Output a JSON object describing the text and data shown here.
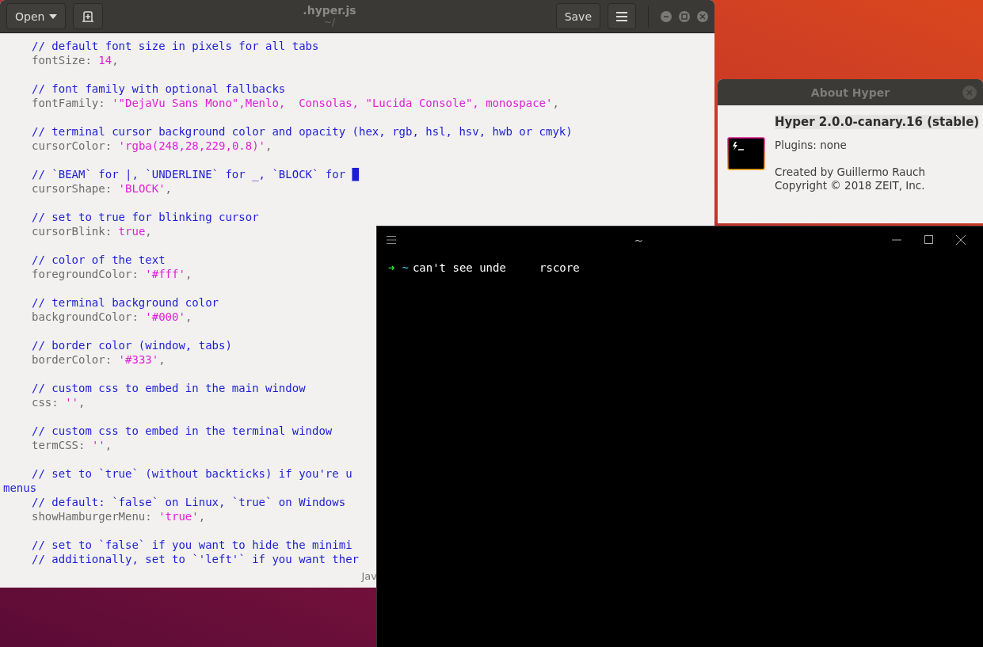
{
  "editor": {
    "title": ".hyper.js",
    "subtitle": "~/",
    "open_button": "Open",
    "save_button": "Save",
    "blocks": [
      {
        "comments": [
          {
            "text": "// default font size in pixels for all tabs",
            "wrapped": false
          }
        ],
        "key": "fontSize:",
        "value": "14",
        "end": ","
      },
      {
        "comments": [
          {
            "text": "// font family with optional fallbacks",
            "wrapped": false
          }
        ],
        "key": "fontFamily:",
        "value": "'\"DejaVu Sans Mono\",Menlo,  Consolas, \"Lucida Console\", monospace'",
        "end": ","
      },
      {
        "comments": [
          {
            "text": "// terminal cursor background color and opacity (hex, rgb, hsl, hsv, hwb or cmyk)",
            "wrapped": false
          }
        ],
        "key": "cursorColor:",
        "value": "'rgba(248,28,229,0.8)'",
        "end": ","
      },
      {
        "comments": [
          {
            "text": "// `BEAM` for |, `UNDERLINE` for _, `BLOCK` for █",
            "wrapped": false
          }
        ],
        "key": "cursorShape:",
        "value": "'BLOCK'",
        "end": ","
      },
      {
        "comments": [
          {
            "text": "// set to true for blinking cursor",
            "wrapped": false
          }
        ],
        "key": "cursorBlink:",
        "value": "true",
        "end": ","
      },
      {
        "comments": [
          {
            "text": "// color of the text",
            "wrapped": false
          }
        ],
        "key": "foregroundColor:",
        "value": "'#fff'",
        "end": ","
      },
      {
        "comments": [
          {
            "text": "// terminal background color",
            "wrapped": false
          }
        ],
        "key": "backgroundColor:",
        "value": "'#000'",
        "end": ","
      },
      {
        "comments": [
          {
            "text": "// border color (window, tabs)",
            "wrapped": false
          }
        ],
        "key": "borderColor:",
        "value": "'#333'",
        "end": ","
      },
      {
        "comments": [
          {
            "text": "// custom css to embed in the main window",
            "wrapped": false
          }
        ],
        "key": "css:",
        "value": "''",
        "end": ","
      },
      {
        "comments": [
          {
            "text": "// custom css to embed in the terminal window",
            "wrapped": false
          }
        ],
        "key": "termCSS:",
        "value": "''",
        "end": ","
      },
      {
        "comments": [
          {
            "text": "// set to `true` (without backticks) if you're u",
            "wrapped": false
          },
          {
            "text": "menus",
            "wrapped": true
          },
          {
            "text": "// default: `false` on Linux, `true` on Windows",
            "wrapped": false
          }
        ],
        "key": "showHamburgerMenu:",
        "value": "'true'",
        "end": ","
      },
      {
        "comments": [
          {
            "text": "// set to `false` if you want to hide the minimi",
            "wrapped": false
          },
          {
            "text": "// additionally, set to `'left'` if you want ther",
            "wrapped": false
          }
        ]
      }
    ],
    "status": "Jav"
  },
  "about": {
    "title": "About Hyper",
    "heading": "Hyper 2.0.0-canary.16 (stable)",
    "plugins": "Plugins: none",
    "lines": [
      "Created by Guillermo Rauch",
      "Copyright © 2018 ZEIT, Inc."
    ]
  },
  "terminal": {
    "title": "~",
    "prompt_arrow": "➜",
    "cwd": "~",
    "command": "can't see unde     rscore"
  }
}
